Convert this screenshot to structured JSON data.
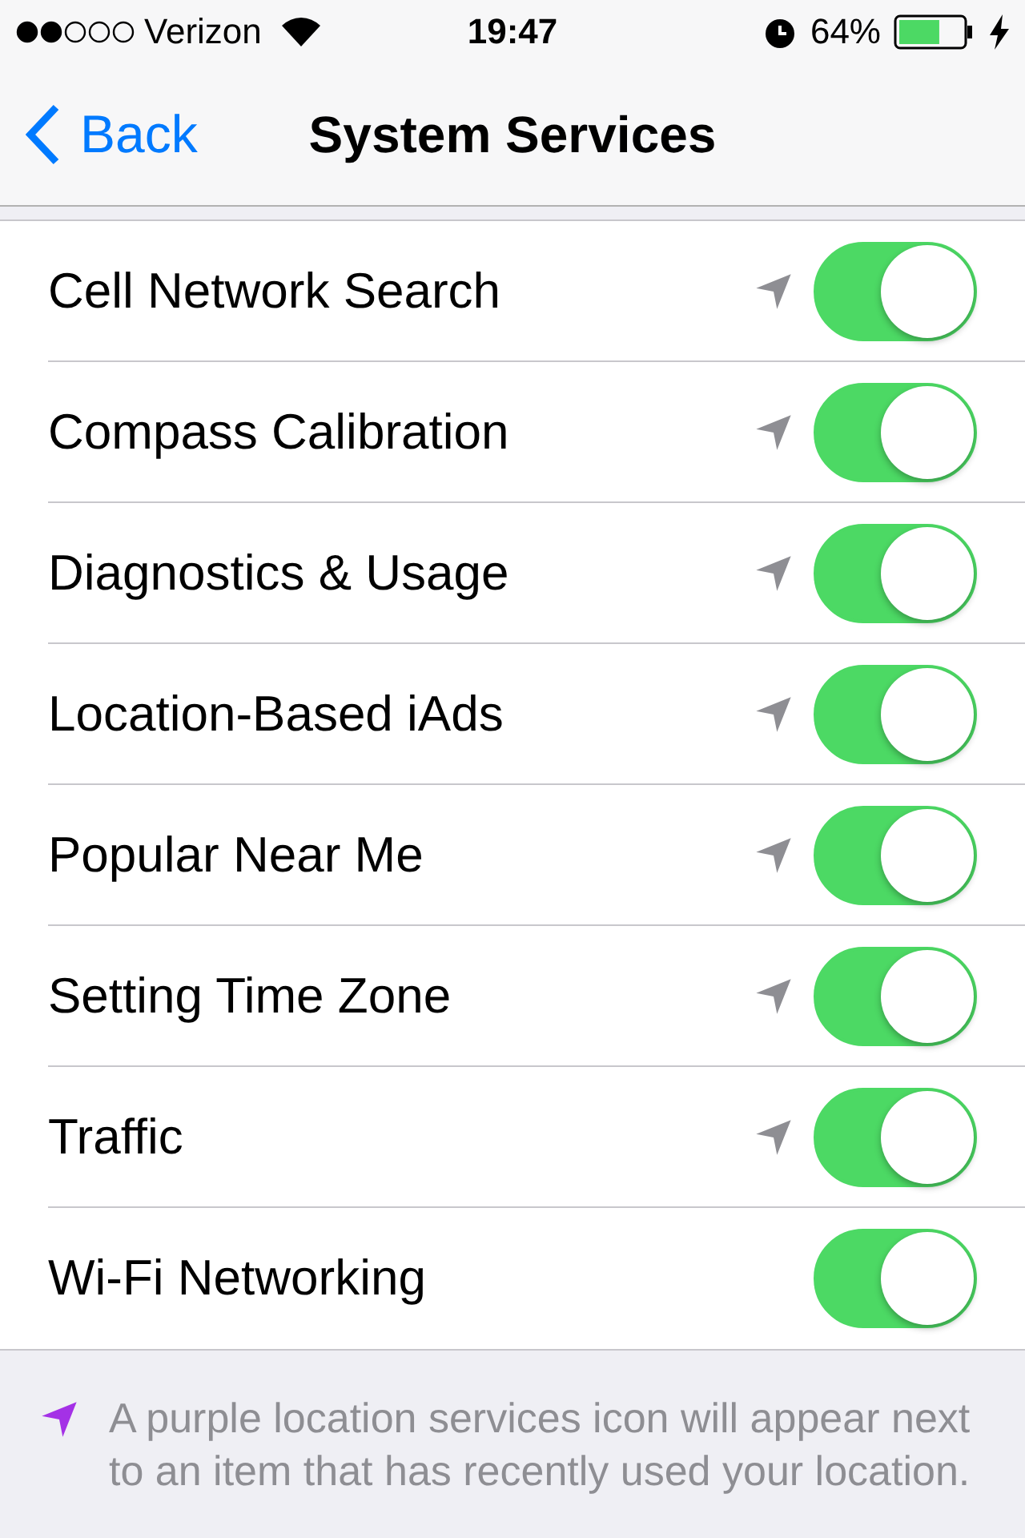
{
  "status_bar": {
    "carrier": "Verizon",
    "time": "19:47",
    "battery": "64%",
    "charging": true
  },
  "nav": {
    "back": "Back",
    "title": "System Services"
  },
  "rows": [
    {
      "label": "Cell Network Search",
      "location_used": true,
      "on": true
    },
    {
      "label": "Compass Calibration",
      "location_used": true,
      "on": true
    },
    {
      "label": "Diagnostics & Usage",
      "location_used": true,
      "on": true
    },
    {
      "label": "Location-Based iAds",
      "location_used": true,
      "on": true
    },
    {
      "label": "Popular Near Me",
      "location_used": true,
      "on": true
    },
    {
      "label": "Setting Time Zone",
      "location_used": true,
      "on": true
    },
    {
      "label": "Traffic",
      "location_used": true,
      "on": true
    },
    {
      "label": "Wi-Fi Networking",
      "location_used": false,
      "on": true
    }
  ],
  "footer": {
    "text": "A purple location services icon will appear next to an item that has recently used your location."
  }
}
